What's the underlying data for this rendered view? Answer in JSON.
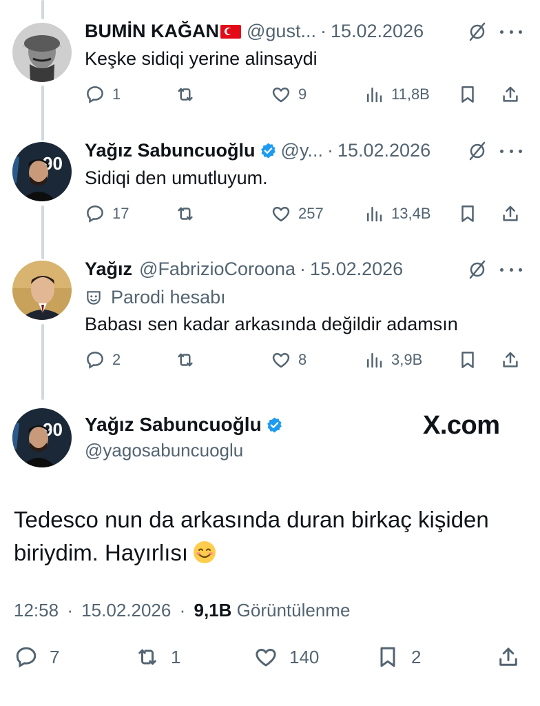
{
  "replies": [
    {
      "name": "BUMİN KAĞAN",
      "handle": "@gust...",
      "date": "15.02.2026",
      "text": "Keşke sidiqi yerine alinsaydi",
      "reply_count": "1",
      "like_count": "9",
      "view_count": "11,8B"
    },
    {
      "name": "Yağız Sabuncuoğlu",
      "handle": "@y...",
      "date": "15.02.2026",
      "text": "Sidiqi den umutluyum.",
      "reply_count": "17",
      "like_count": "257",
      "view_count": "13,4B"
    },
    {
      "name": "Yağız",
      "handle": "@FabrizioCoroona",
      "date": "15.02.2026",
      "parody_label": "Parodi hesabı",
      "text": "Babası sen kadar arkasında değildir adamsın",
      "reply_count": "2",
      "like_count": "8",
      "view_count": "3,9B"
    }
  ],
  "main_tweet": {
    "name": "Yağız Sabuncuoğlu",
    "handle": "@yagosabuncuoglu",
    "watermark": "X.com",
    "text_line1": "Tedesco nun da arkasında duran birkaç kişiden",
    "text_line2": "biriydim. Hayırlısı",
    "time": "12:58",
    "date": "15.02.2026",
    "views": "9,1B",
    "views_label": "Görüntülenme",
    "reply_count": "7",
    "retweet_count": "1",
    "like_count": "140",
    "bookmark_count": "2"
  },
  "separator": "·",
  "colors": {
    "text": "#0f1419",
    "secondary": "#536471",
    "verified": "#1d9bf0",
    "thread_line": "#cfd9de"
  }
}
